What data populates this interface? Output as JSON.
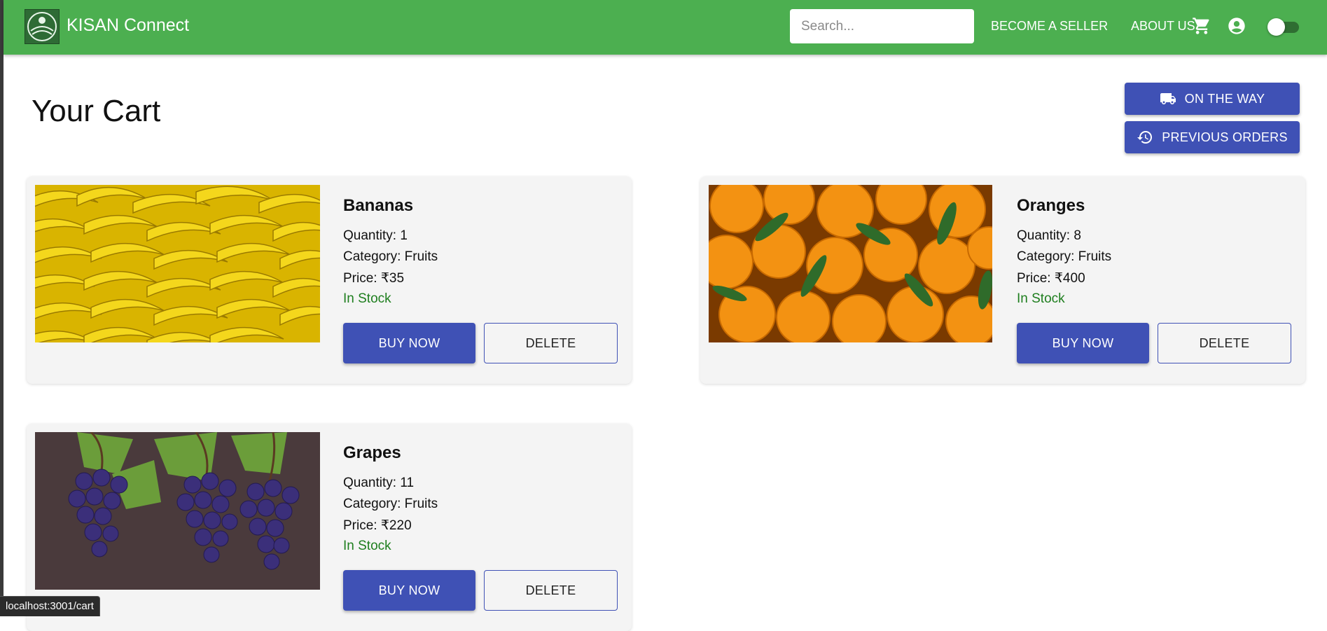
{
  "app": {
    "brand": "KISAN Connect"
  },
  "search": {
    "placeholder": "Search..."
  },
  "nav": {
    "become_seller": "BECOME A SELLER",
    "about_us": "ABOUT US",
    "icons": [
      "cart-icon",
      "account-circle-icon"
    ],
    "theme_toggle_on": false
  },
  "page": {
    "title": "Your Cart"
  },
  "actions": {
    "on_the_way": "ON THE WAY",
    "previous_orders": "PREVIOUS ORDERS"
  },
  "cart": {
    "items": [
      {
        "name": "Bananas",
        "quantity": "Quantity: 1",
        "category": "Category: Fruits",
        "price": "Price: ₹35",
        "stock": "In Stock",
        "buy": "BUY NOW",
        "delete": "DELETE"
      },
      {
        "name": "Oranges",
        "quantity": "Quantity: 8",
        "category": "Category: Fruits",
        "price": "Price: ₹400",
        "stock": "In Stock",
        "buy": "BUY NOW",
        "delete": "DELETE"
      },
      {
        "name": "Grapes",
        "quantity": "Quantity: 11",
        "category": "Category: Fruits",
        "price": "Price: ₹220",
        "stock": "In Stock",
        "buy": "BUY NOW",
        "delete": "DELETE"
      }
    ]
  },
  "status_bar": {
    "url": "localhost:3001/cart"
  },
  "colors": {
    "appbar": "#4caf50",
    "primary": "#3f51b5",
    "in_stock": "#1e7e1e",
    "card_bg": "#f4f4f4"
  }
}
